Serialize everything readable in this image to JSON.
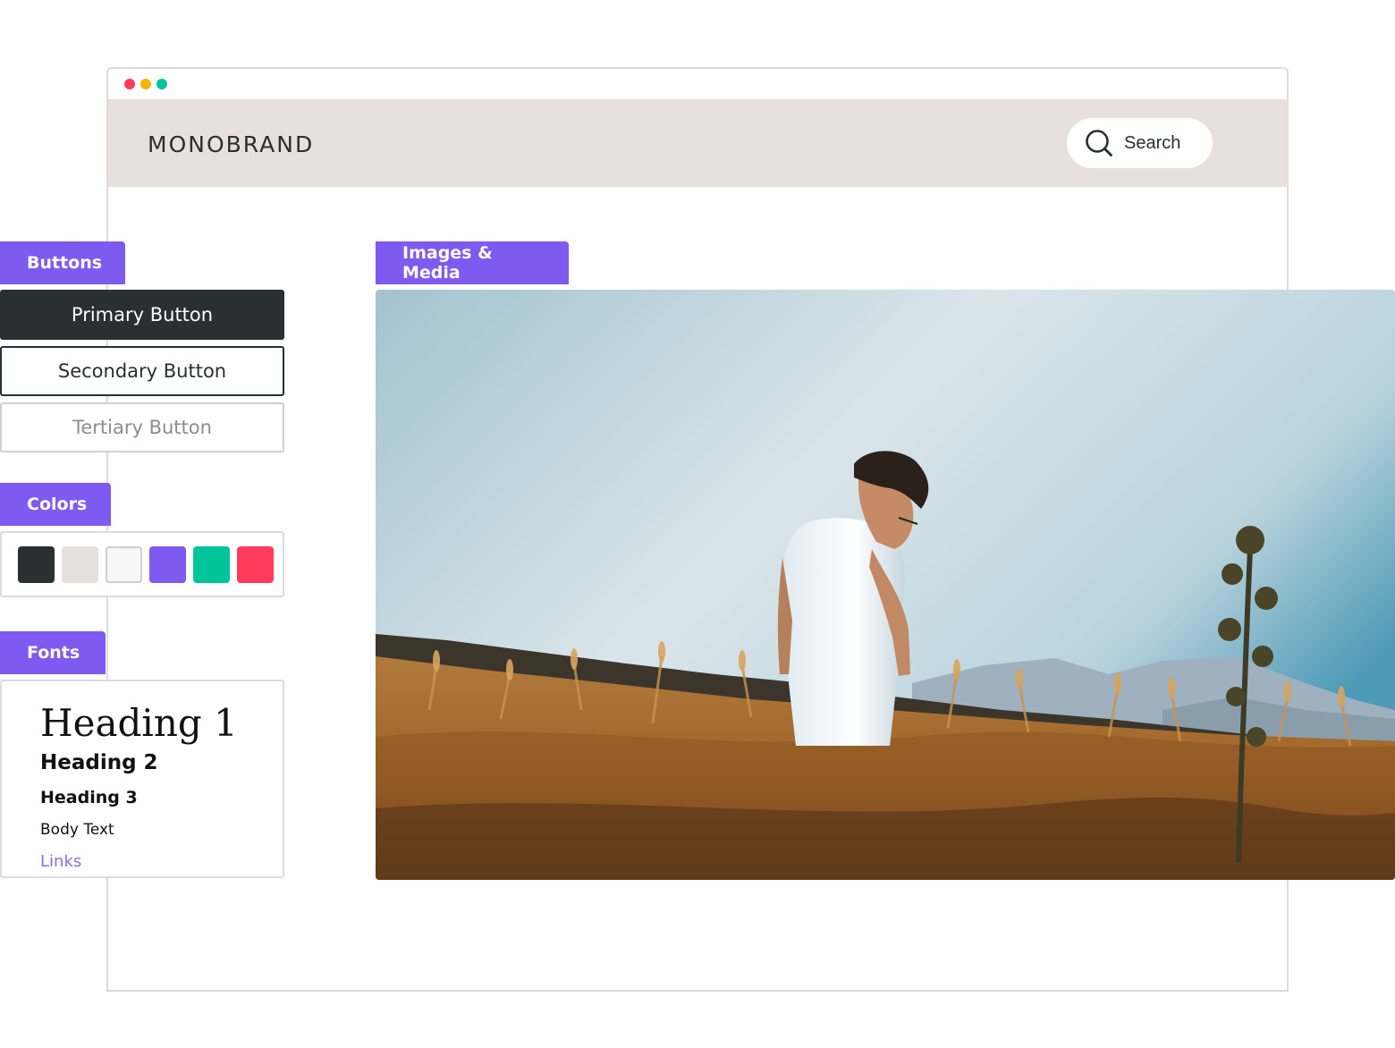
{
  "window": {
    "traffic_colors": [
      "#ff3b5c",
      "#f7b500",
      "#00c49a"
    ]
  },
  "header": {
    "logo": "MONOBRAND",
    "search_label": "Search",
    "background": "#e8dfdf"
  },
  "sections": {
    "buttons": "Buttons",
    "colors": "Colors",
    "fonts": "Fonts",
    "media": "Images & Media"
  },
  "buttons": {
    "primary": "Primary Button",
    "secondary": "Secondary Button",
    "tertiary": "Tertiary Button"
  },
  "palette": [
    "#2a2f2f",
    "#e8dfdf",
    "#f7f7f7",
    "#7f5af0",
    "#00c49a",
    "#ff3b5c"
  ],
  "fonts": {
    "heading1": "Heading 1",
    "heading2": "Heading 2",
    "heading3": "Heading 3",
    "body": "Body Text",
    "link": "Links"
  },
  "accent_color": "#7f5af0",
  "media": {
    "icon": "photo-man-in-wheat-field"
  }
}
